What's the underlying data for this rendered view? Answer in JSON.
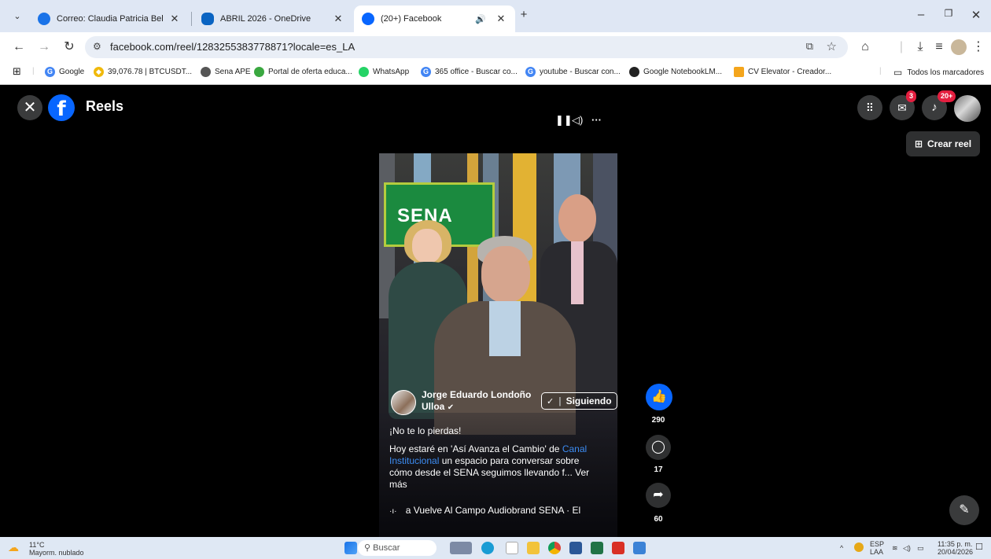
{
  "browser": {
    "tabs": [
      {
        "title": "Correo: Claudia Patricia Beltran M",
        "color": "#1a73e8"
      },
      {
        "title": "ABRIL 2026 - OneDrive",
        "color": "#0a64c2"
      },
      {
        "title": "(20+) Facebook",
        "color": "#0866ff",
        "active": true
      }
    ],
    "address": "facebook.com/reel/1283255383778871?locale=es_LA",
    "bookmarks": [
      {
        "label": "Google",
        "icon": "G",
        "color": "#4285f4"
      },
      {
        "label": "39,076.78 | BTCUSDT...",
        "icon": "◆",
        "color": "#f0b90b"
      },
      {
        "label": "Sena APE",
        "icon": "●",
        "color": "#555555"
      },
      {
        "label": "Portal de oferta educa...",
        "icon": "●",
        "color": "#3aa840"
      },
      {
        "label": "WhatsApp",
        "icon": "●",
        "color": "#25d366"
      },
      {
        "label": "365 office - Buscar co...",
        "icon": "G",
        "color": "#4285f4"
      },
      {
        "label": "youtube - Buscar con...",
        "icon": "G",
        "color": "#4285f4"
      },
      {
        "label": "Google NotebookLM...",
        "icon": "●",
        "color": "#222222"
      },
      {
        "label": "CV Elevator - Creador...",
        "icon": "●",
        "color": "#f4a51c"
      }
    ],
    "all_bookmarks": "Todos los marcadores"
  },
  "page": {
    "title": "Reels",
    "messenger_badge": "3",
    "notifications_badge": "20+",
    "crear_reel": "Crear reel",
    "reel": {
      "author_line1": "Jorge Eduardo Londoño",
      "author_line2": "Ulloa",
      "follow_label": "Siguiendo",
      "caption_intro": "¡No te lo pierdas!",
      "caption_a": "Hoy estaré en 'Así Avanza el Cambio' de ",
      "caption_link1": "Canal",
      "caption_link2": "Institucional",
      "caption_b": " un espacio para conversar sobre",
      "caption_c": "cómo desde el SENA seguimos llevando f... Ver",
      "caption_more": "más",
      "audio": "a Vuelve Al Campo      Audiobrand SENA · El",
      "screen_word": "SENA",
      "likes": "290",
      "comments": "17",
      "shares": "60"
    }
  },
  "taskbar": {
    "weather_temp": "11°C",
    "weather_desc": "Mayorm. nublado",
    "search": "Buscar",
    "lang1": "ESP",
    "lang2": "LAA",
    "time": "11:35 p. m.",
    "date": "20/04/2026"
  }
}
